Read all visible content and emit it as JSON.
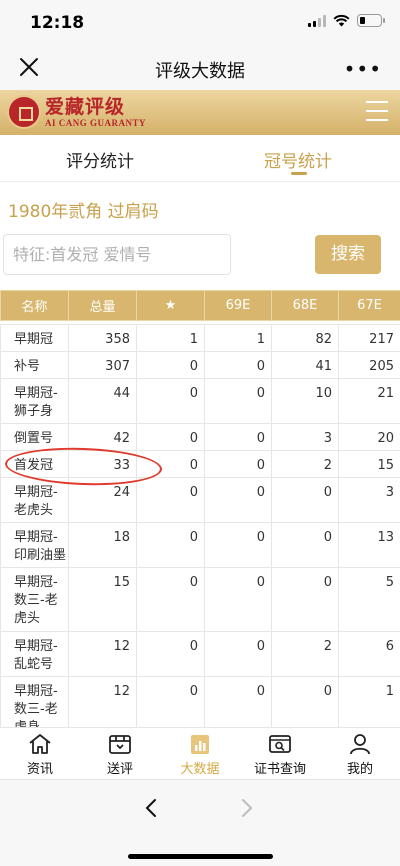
{
  "status": {
    "time": "12:18"
  },
  "nav": {
    "title": "评级大数据",
    "more": "•••"
  },
  "brand": {
    "logo_cn": "爱藏评级",
    "logo_en": "AI CANG GUARANTY"
  },
  "tabs": [
    {
      "label": "评分统计",
      "active": false
    },
    {
      "label": "冠号统计",
      "active": true
    }
  ],
  "subtitle": "1980年贰角 过肩码",
  "search": {
    "placeholder": "特征:首发冠 爱情号",
    "value": "",
    "button": "搜索"
  },
  "table": {
    "headers": [
      "名称",
      "总量",
      "★",
      "69E",
      "68E",
      "67E"
    ],
    "rows": [
      {
        "name": [
          "早期冠"
        ],
        "values": [
          "358",
          "1",
          "1",
          "82",
          "217"
        ]
      },
      {
        "name": [
          "补号"
        ],
        "values": [
          "307",
          "0",
          "0",
          "41",
          "205"
        ]
      },
      {
        "name": [
          "早期冠-",
          "狮子身"
        ],
        "values": [
          "44",
          "0",
          "0",
          "10",
          "21"
        ]
      },
      {
        "name": [
          "倒置号"
        ],
        "values": [
          "42",
          "0",
          "0",
          "3",
          "20"
        ]
      },
      {
        "name": [
          "首发冠"
        ],
        "values": [
          "33",
          "0",
          "0",
          "2",
          "15"
        ]
      },
      {
        "name": [
          "早期冠-",
          "老虎头"
        ],
        "values": [
          "24",
          "0",
          "0",
          "0",
          "3"
        ]
      },
      {
        "name": [
          "早期冠-",
          "印刷油墨"
        ],
        "values": [
          "18",
          "0",
          "0",
          "0",
          "13"
        ]
      },
      {
        "name": [
          "早期冠-",
          "数三-老",
          "虎头"
        ],
        "values": [
          "15",
          "0",
          "0",
          "0",
          "5"
        ]
      },
      {
        "name": [
          "早期冠-",
          "乱蛇号"
        ],
        "values": [
          "12",
          "0",
          "0",
          "2",
          "6"
        ]
      },
      {
        "name": [
          "早期冠-",
          "数三-老",
          "虎身"
        ],
        "values": [
          "12",
          "0",
          "0",
          "0",
          "1"
        ]
      }
    ]
  },
  "bottom_nav": [
    {
      "label": "资讯",
      "icon": "home-icon",
      "active": false
    },
    {
      "label": "送评",
      "icon": "box-icon",
      "active": false
    },
    {
      "label": "大数据",
      "icon": "bar-chart-icon",
      "active": true
    },
    {
      "label": "证书查询",
      "icon": "certificate-search-icon",
      "active": false
    },
    {
      "label": "我的",
      "icon": "user-icon",
      "active": false
    }
  ],
  "colors": {
    "gold": "#d9b66d",
    "accent_text": "#c9a14c",
    "highlight": "#e03a2c"
  }
}
